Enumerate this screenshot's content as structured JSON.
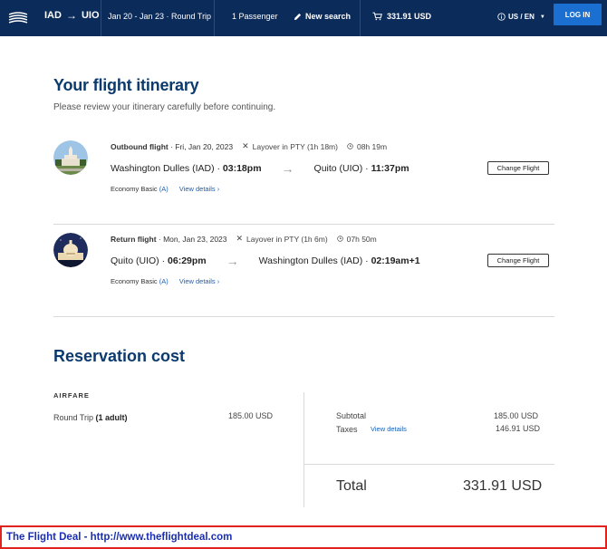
{
  "header": {
    "origin": "IAD",
    "destination": "UIO",
    "dates": "Jan 20 - Jan 23 · Round Trip",
    "passengers": "1 Passenger",
    "new_search": "New search",
    "price": "331.91 USD",
    "locale": "US / EN",
    "login": "LOG IN"
  },
  "page": {
    "title": "Your flight itinerary",
    "subtitle": "Please review your itinerary carefully before continuing."
  },
  "flights": [
    {
      "label": "Outbound flight",
      "date": " · Fri, Jan 20, 2023",
      "layover": "Layover in PTY (1h 18m)",
      "duration": "08h 19m",
      "from": "Washington Dulles (IAD)",
      "depart": "03:18pm",
      "to": "Quito (UIO)",
      "arrive": "11:37pm",
      "fare": "Economy Basic",
      "fare_code": "(A)",
      "details": "View details",
      "change": "Change Flight"
    },
    {
      "label": "Return flight",
      "date": " · Mon, Jan 23, 2023",
      "layover": "Layover in PTY (1h 6m)",
      "duration": "07h 50m",
      "from": "Quito (UIO)",
      "depart": "06:29pm",
      "to": "Washington Dulles (IAD)",
      "arrive": "02:19am+1",
      "fare": "Economy Basic",
      "fare_code": "(A)",
      "details": "View details",
      "change": "Change Flight"
    }
  ],
  "cost": {
    "title": "Reservation cost",
    "airfare_label": "AIRFARE",
    "round_trip": "Round Trip",
    "adults": "(1 adult)",
    "round_trip_amount": "185.00 USD",
    "subtotal_label": "Subtotal",
    "subtotal_amount": "185.00 USD",
    "taxes_label": "Taxes",
    "taxes_link": "View details",
    "taxes_amount": "146.91 USD",
    "total_label": "Total",
    "total_amount": "331.91 USD"
  },
  "banner": {
    "text": "The Flight Deal - http://www.theflightdeal.com"
  },
  "colors": {
    "header_bg": "#0b2b5a",
    "accent": "#1a6fd0",
    "title": "#0b3a6e",
    "link": "#1a5fb4",
    "banner_border": "#e0231f",
    "banner_text": "#1a2fb0"
  }
}
